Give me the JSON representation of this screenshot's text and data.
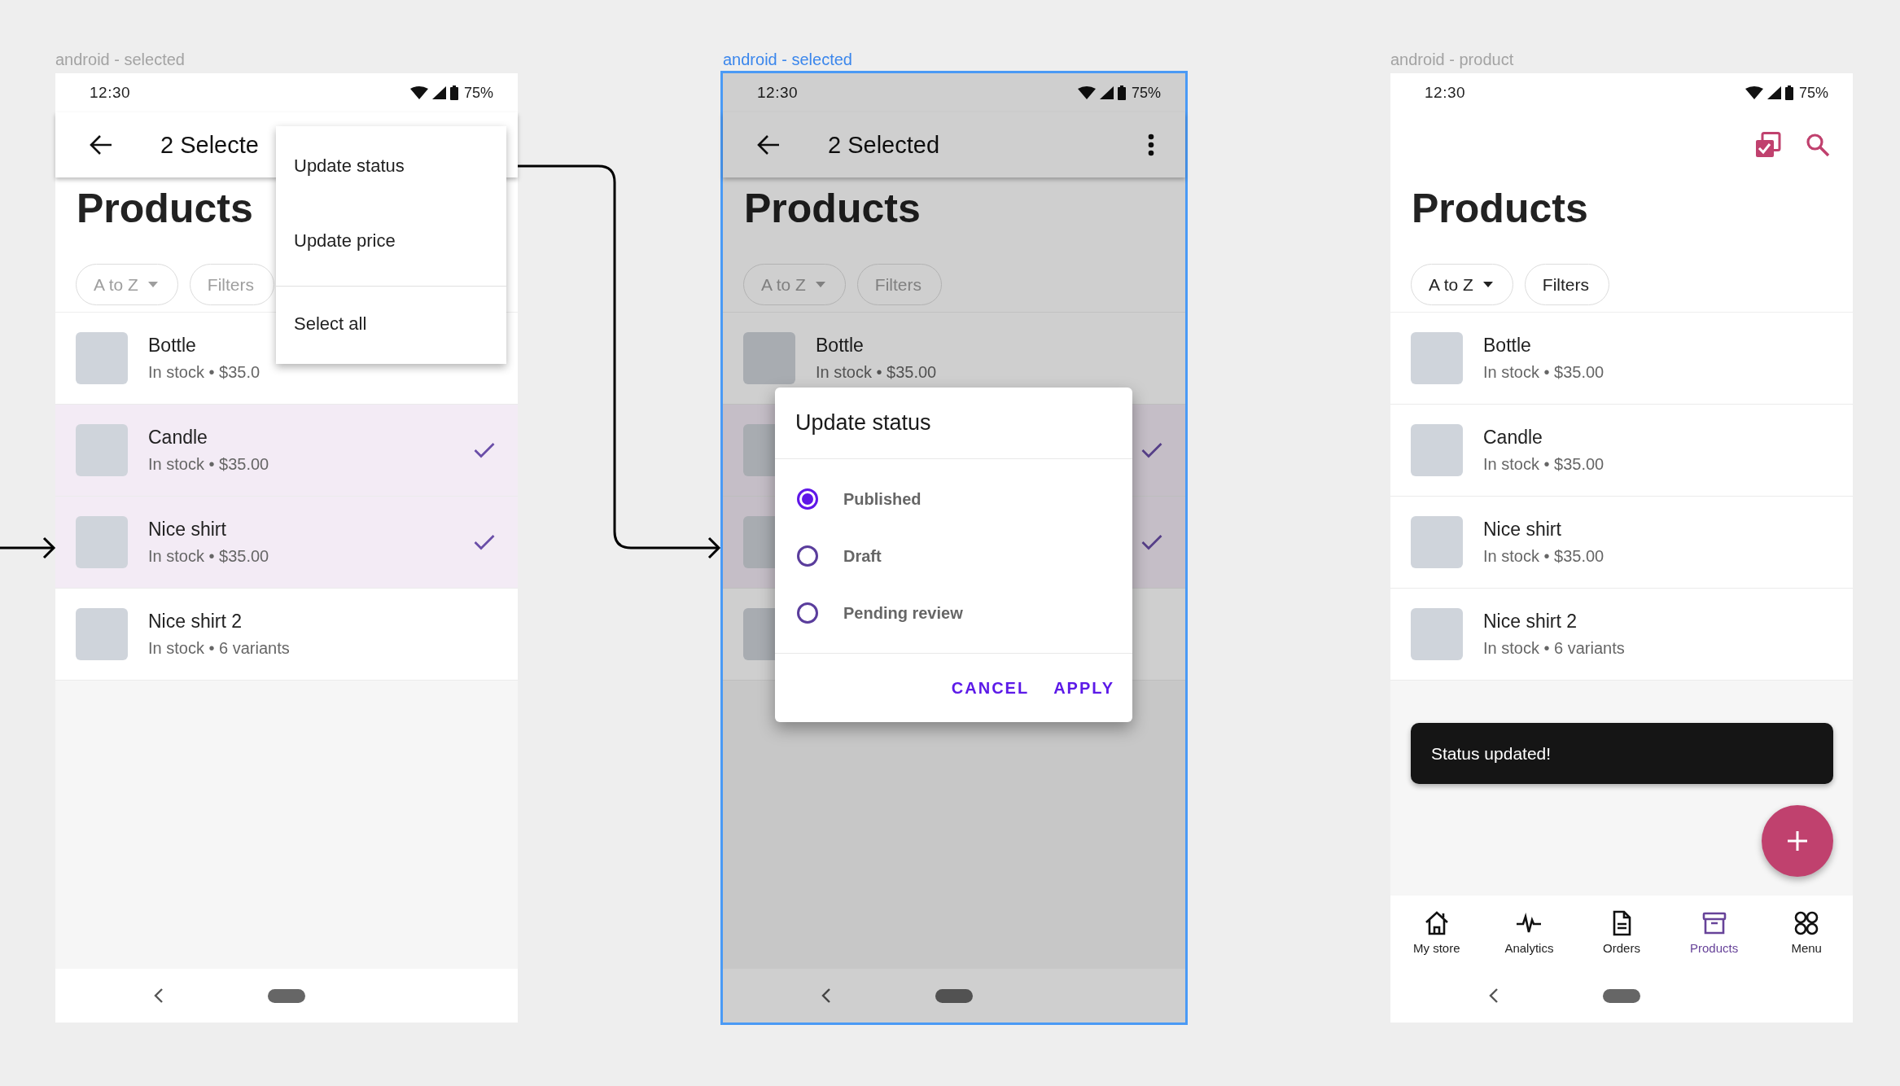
{
  "frames": [
    {
      "label": "android - selected",
      "selected": false,
      "status_bar": {
        "time": "12:30",
        "battery": "75%"
      },
      "app_bar": {
        "kind": "selection",
        "title": "2 Selecte"
      },
      "menu": {
        "items": [
          {
            "label": "Update status",
            "divider_before": false
          },
          {
            "label": "Update price",
            "divider_before": false
          },
          {
            "label": "Select all",
            "divider_before": true
          }
        ]
      },
      "page_title": "Products",
      "chips": [
        {
          "label": "A to Z",
          "dropdown": true,
          "disabled": true
        },
        {
          "label": "Filters",
          "dropdown": false,
          "disabled": true
        }
      ],
      "products": [
        {
          "name": "Bottle",
          "detail": "In stock • $35.0",
          "selected": false
        },
        {
          "name": "Candle",
          "detail": "In stock • $35.00",
          "selected": true
        },
        {
          "name": "Nice shirt",
          "detail": "In stock • $35.00",
          "selected": true
        },
        {
          "name": "Nice shirt 2",
          "detail": "In stock • 6 variants",
          "selected": false
        }
      ]
    },
    {
      "label": "android - selected",
      "selected": true,
      "status_bar": {
        "time": "12:30",
        "battery": "75%"
      },
      "app_bar": {
        "kind": "selection",
        "title": "2 Selected"
      },
      "page_title": "Products",
      "chips": [
        {
          "label": "A to Z",
          "dropdown": true,
          "disabled": true
        },
        {
          "label": "Filters",
          "dropdown": false,
          "disabled": true
        }
      ],
      "products": [
        {
          "name": "Bottle",
          "detail": "In stock • $35.00",
          "selected": false
        },
        {
          "selected": true
        },
        {
          "selected": true
        },
        {
          "selected": false
        }
      ],
      "dialog": {
        "title": "Update status",
        "options": [
          {
            "label": "Published",
            "selected": true
          },
          {
            "label": "Draft",
            "selected": false
          },
          {
            "label": "Pending review",
            "selected": false
          }
        ],
        "actions": [
          "CANCEL",
          "APPLY"
        ]
      }
    },
    {
      "label": "android - product",
      "selected": false,
      "status_bar": {
        "time": "12:30",
        "battery": "75%"
      },
      "app_bar": {
        "kind": "actions"
      },
      "page_title": "Products",
      "chips": [
        {
          "label": "A to Z",
          "dropdown": true,
          "disabled": false
        },
        {
          "label": "Filters",
          "dropdown": false,
          "disabled": false
        }
      ],
      "products": [
        {
          "name": "Bottle",
          "detail": "In stock • $35.00",
          "selected": false
        },
        {
          "name": "Candle",
          "detail": "In stock • $35.00",
          "selected": false
        },
        {
          "name": "Nice shirt",
          "detail": "In stock • $35.00",
          "selected": false
        },
        {
          "name": "Nice shirt 2",
          "detail": "In stock • 6 variants",
          "selected": false
        }
      ],
      "snackbar": "Status updated!",
      "fab": true,
      "bottom_nav": [
        {
          "label": "My store",
          "selected": false
        },
        {
          "label": "Analytics",
          "selected": false
        },
        {
          "label": "Orders",
          "selected": false
        },
        {
          "label": "Products",
          "selected": true
        },
        {
          "label": "Menu",
          "selected": false
        }
      ]
    }
  ]
}
